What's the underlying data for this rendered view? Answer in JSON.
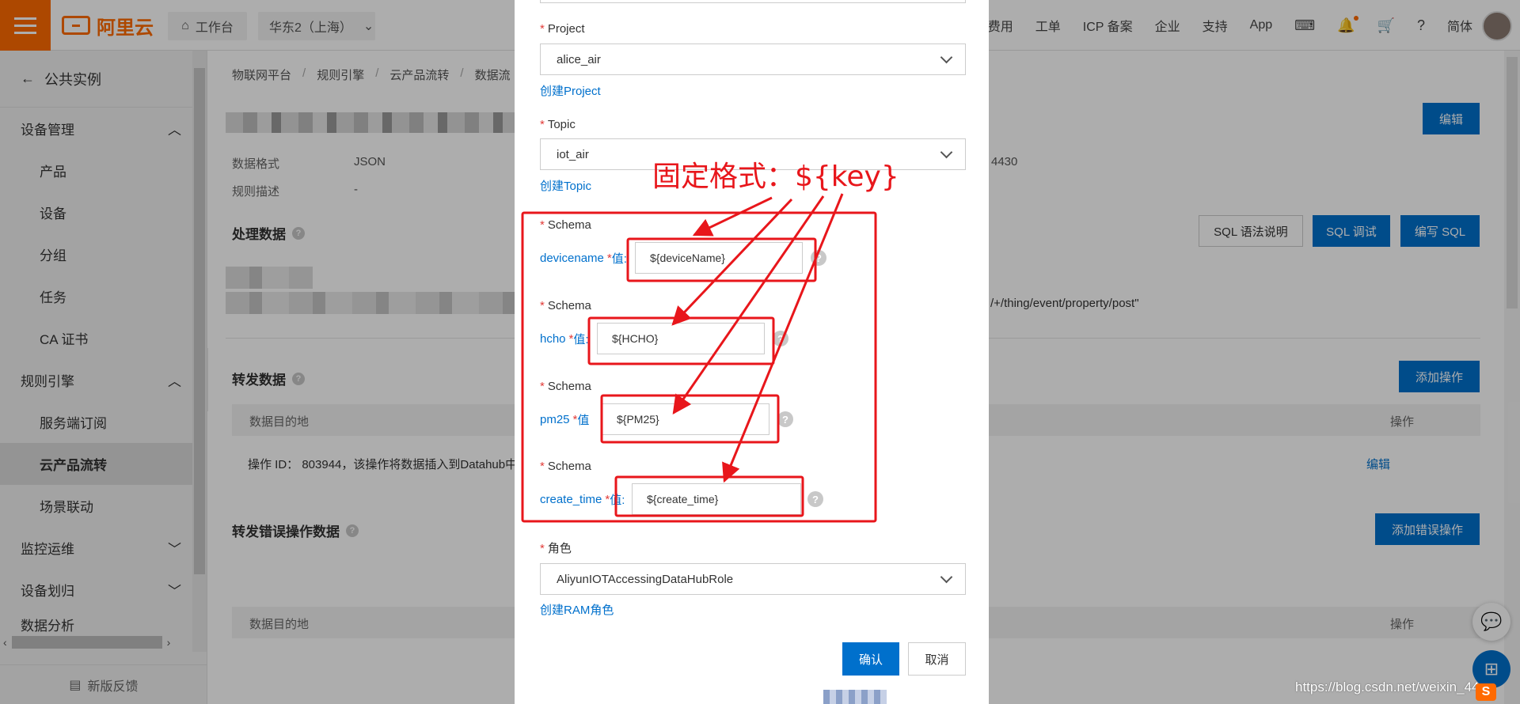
{
  "topbar": {
    "workbench": "工作台",
    "region": "华东2（上海）",
    "nav": [
      "费用",
      "工单",
      "ICP 备案",
      "企业",
      "支持",
      "App"
    ],
    "language": "简体"
  },
  "sidebar": {
    "back_label": "公共实例",
    "groups": [
      {
        "label": "设备管理",
        "items": [
          "产品",
          "设备",
          "分组",
          "任务",
          "CA 证书"
        ]
      },
      {
        "label": "规则引擎",
        "items": [
          "服务端订阅",
          "云产品流转",
          "场景联动"
        ]
      }
    ],
    "collapsed_groups": [
      "监控运维",
      "设备划归"
    ],
    "cut_label": "数据分析",
    "active_item": "云产品流转",
    "feedback": "新版反馈"
  },
  "main": {
    "breadcrumb": [
      "物联网平台",
      "规则引擎",
      "云产品流转",
      "数据流"
    ],
    "edit_button": "编辑",
    "format_label": "数据格式",
    "format_value": "JSON",
    "desc_label": "规则描述",
    "desc_value": "-",
    "id_suffix": "4430",
    "process_title": "处理数据",
    "sql_help": "SQL 语法说明",
    "sql_debug": "SQL 调试",
    "sql_write": "编写 SQL",
    "sql_tail": "/+/thing/event/property/post\"",
    "forward_title": "转发数据",
    "add_operation": "添加操作",
    "col_dest": "数据目的地",
    "col_op": "操作",
    "op_text": "操作 ID：  803944，该操作将数据插入到Datahub中",
    "op_edit": "编辑",
    "error_title": "转发错误操作数据",
    "add_error_operation": "添加错误操作"
  },
  "modal": {
    "project_label": "Project",
    "project_value": "alice_air",
    "create_project": "创建Project",
    "topic_label": "Topic",
    "topic_value": "iot_air",
    "create_topic": "创建Topic",
    "schema_label": "Schema",
    "value_label": "值:",
    "schemas": [
      {
        "field": "devicename",
        "value": "${deviceName}"
      },
      {
        "field": "hcho",
        "value": "${HCHO}"
      },
      {
        "field": "pm25",
        "value": "${PM25}"
      },
      {
        "field": "create_time",
        "value": "${create_time}"
      }
    ],
    "role_label": "角色",
    "role_value": "AliyunIOTAccessingDataHubRole",
    "create_role": "创建RAM角色",
    "confirm": "确认",
    "cancel": "取消"
  },
  "annotation": {
    "text": "固定格式：${key}",
    "color": "#e8161b"
  },
  "watermark": "https://blog.csdn.net/weixin_44"
}
